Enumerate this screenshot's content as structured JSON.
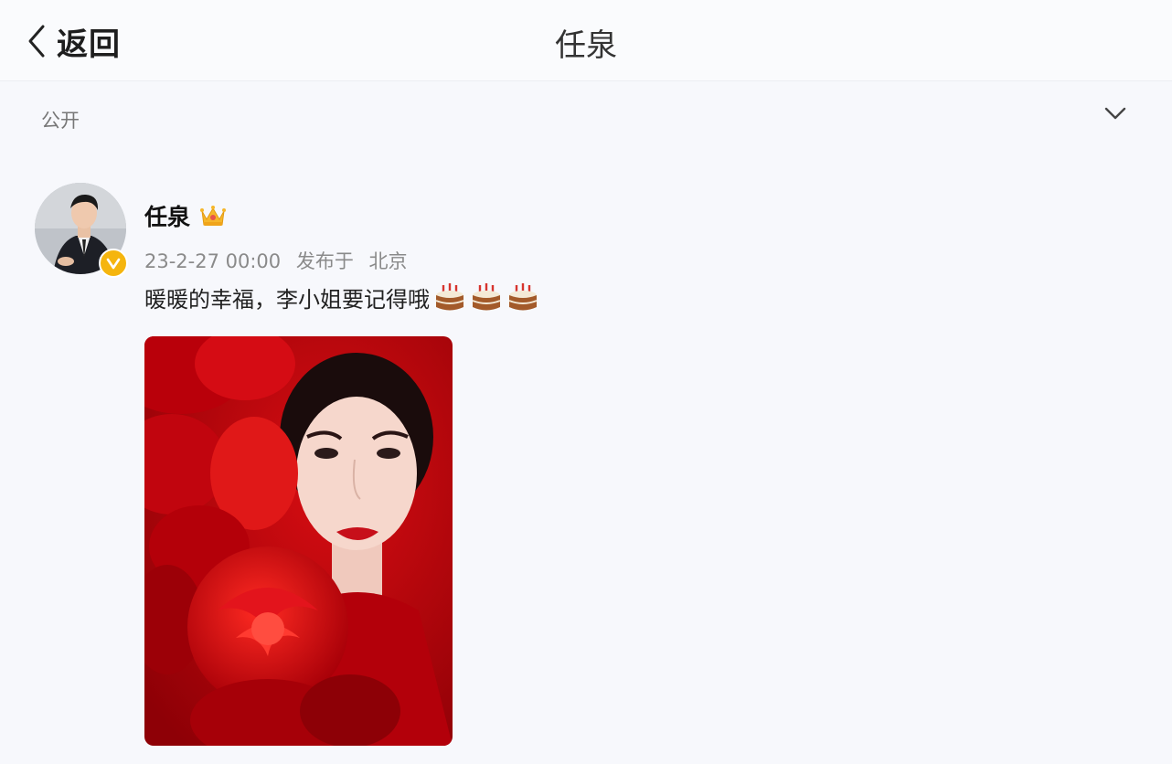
{
  "header": {
    "back_label": "返回",
    "title": "任泉"
  },
  "visibility": {
    "label": "公开"
  },
  "post": {
    "author": "任泉",
    "timestamp": "23-2-27 00:00",
    "published_prefix": "发布于",
    "location": "北京",
    "text": "暖暖的幸福，李小姐要记得哦",
    "emoji": [
      "birthday-cake-icon",
      "birthday-cake-icon",
      "birthday-cake-icon"
    ]
  },
  "colors": {
    "verified_badge": "#f5b50e",
    "photo_red": "#c3000b",
    "background": "#f7f8fc"
  }
}
